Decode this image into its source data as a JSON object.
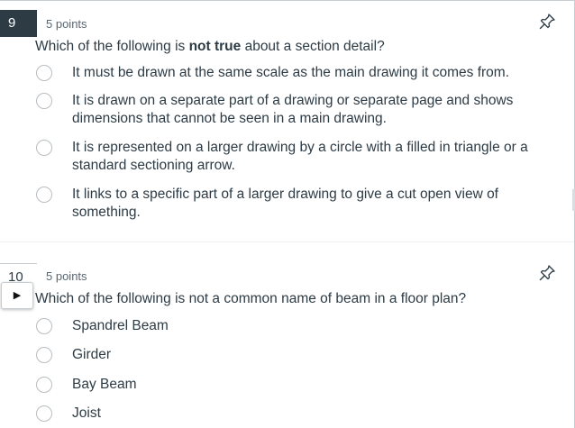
{
  "q9": {
    "number": "9",
    "points": "5 points",
    "question_pre": "Which of the following is ",
    "question_bold": "not true",
    "question_post": " about a section detail?",
    "answers": [
      "It must be drawn at the same scale as the main drawing it comes from.",
      "It is drawn on a separate part of a drawing or separate page and shows dimensions that cannot be seen in a main drawing.",
      "It is represented on a larger drawing by a circle with a filled in triangle or a standard sectioning arrow.",
      "It links to a specific part of a larger drawing to give a cut open view of something."
    ]
  },
  "q10": {
    "number": "10",
    "points": "5 points",
    "question": "Which of the following is not a common name of beam in a floor plan?",
    "answers": [
      "Spandrel Beam",
      "Girder",
      "Bay Beam",
      "Joist"
    ]
  },
  "icons": {
    "pin": "pin-icon",
    "expand": "play-triangle-icon",
    "radio": "radio-circle"
  },
  "colors": {
    "number_badge_bg": "#2d3b45",
    "text": "#2d3b45",
    "border": "#c7cdd1"
  }
}
